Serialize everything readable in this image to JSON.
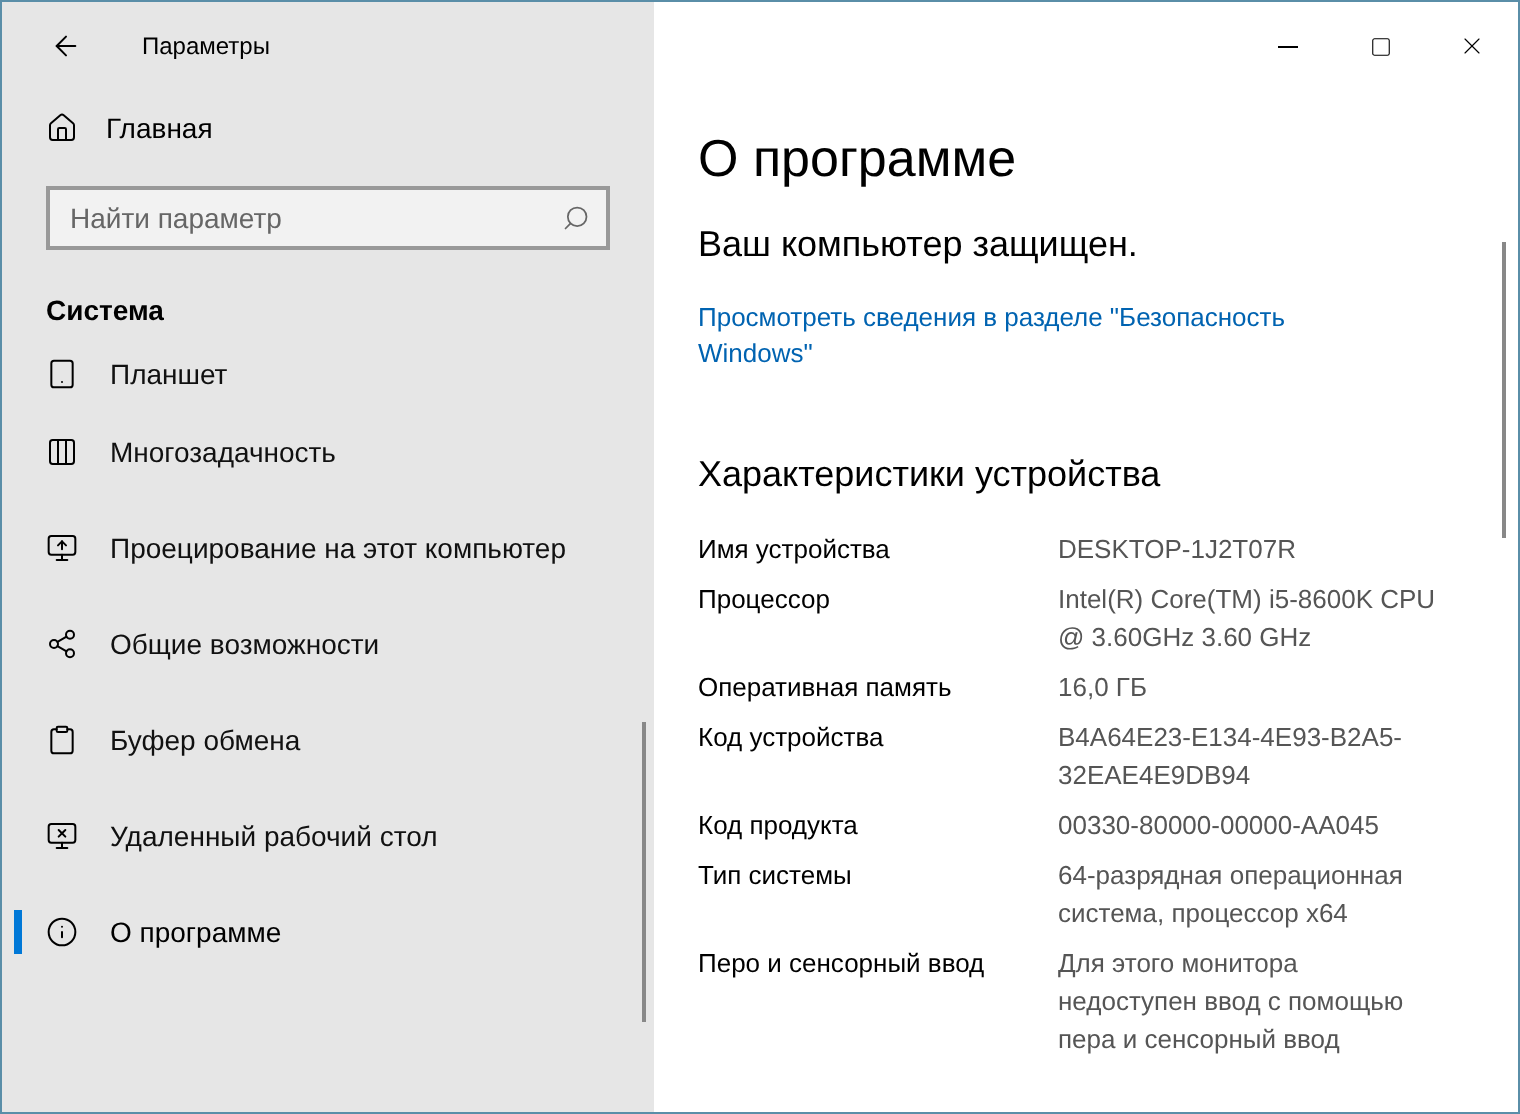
{
  "window": {
    "title": "Параметры"
  },
  "sidebar": {
    "home": "Главная",
    "search": {
      "placeholder": "Найти параметр"
    },
    "section": "Система",
    "items": [
      {
        "label": "Планшет",
        "selected": false
      },
      {
        "label": "Многозадачность",
        "selected": false
      },
      {
        "label": "Проецирование на этот компьютер",
        "selected": false
      },
      {
        "label": "Общие возможности",
        "selected": false
      },
      {
        "label": "Буфер обмена",
        "selected": false
      },
      {
        "label": "Удаленный рабочий стол",
        "selected": false
      },
      {
        "label": "О программе",
        "selected": true
      }
    ]
  },
  "content": {
    "title": "О программе",
    "protection": "Ваш компьютер защищен.",
    "link": "Просмотреть сведения в разделе \"Безопасность Windows\"",
    "specs_title": "Характеристики устройства",
    "specs": [
      {
        "label": "Имя устройства",
        "value": "DESKTOP-1J2T07R"
      },
      {
        "label": "Процессор",
        "value": "Intel(R) Core(TM) i5-8600K CPU @ 3.60GHz   3.60 GHz"
      },
      {
        "label": "Оперативная память",
        "value": "16,0 ГБ"
      },
      {
        "label": "Код устройства",
        "value": "B4A64E23-E134-4E93-B2A5-32EAE4E9DB94"
      },
      {
        "label": "Код продукта",
        "value": "00330-80000-00000-AA045"
      },
      {
        "label": "Тип системы",
        "value": "64-разрядная операционная система, процессор x64"
      },
      {
        "label": "Перо и сенсорный ввод",
        "value": "Для этого монитора недоступен ввод с помощью пера и сенсорный ввод"
      }
    ]
  }
}
